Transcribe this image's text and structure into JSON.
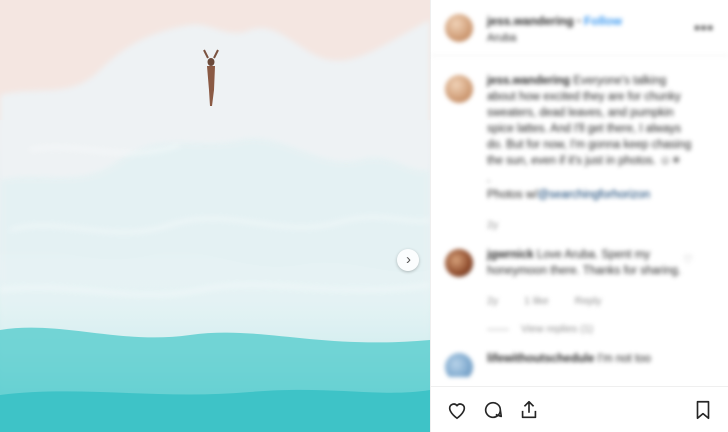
{
  "post": {
    "username": "jess.wandering",
    "follow_label": "Follow",
    "location": "Aruba",
    "caption": "Everyone's talking about how excited they are for chunky sweaters, dead leaves, and pumpkin spice lattes. And I'll get there, I always do. But for now, I'm gonna keep chasing the sun, even if it's just in photos. ☺☀",
    "credit_prefix": "Photos w/",
    "credit_mention": "@searchingforhorizon",
    "caption_time": "2y"
  },
  "comments": [
    {
      "username": "jgwrnick",
      "text": "Love Aruba. Spent my honeymoon there. Thanks for sharing.",
      "time": "2y",
      "likes": "1 like",
      "reply": "Reply",
      "view_replies": "View replies (1)"
    },
    {
      "username": "lifewithoutschedule",
      "text": "I'm not too"
    }
  ],
  "icons": {
    "more": "more-icon",
    "next": "chevron-right-icon",
    "like": "heart-icon",
    "comment": "comment-icon",
    "share": "share-icon",
    "save": "bookmark-icon"
  },
  "colors": {
    "link": "#3897f0",
    "text": "#262626",
    "muted": "#8e8e8e"
  }
}
